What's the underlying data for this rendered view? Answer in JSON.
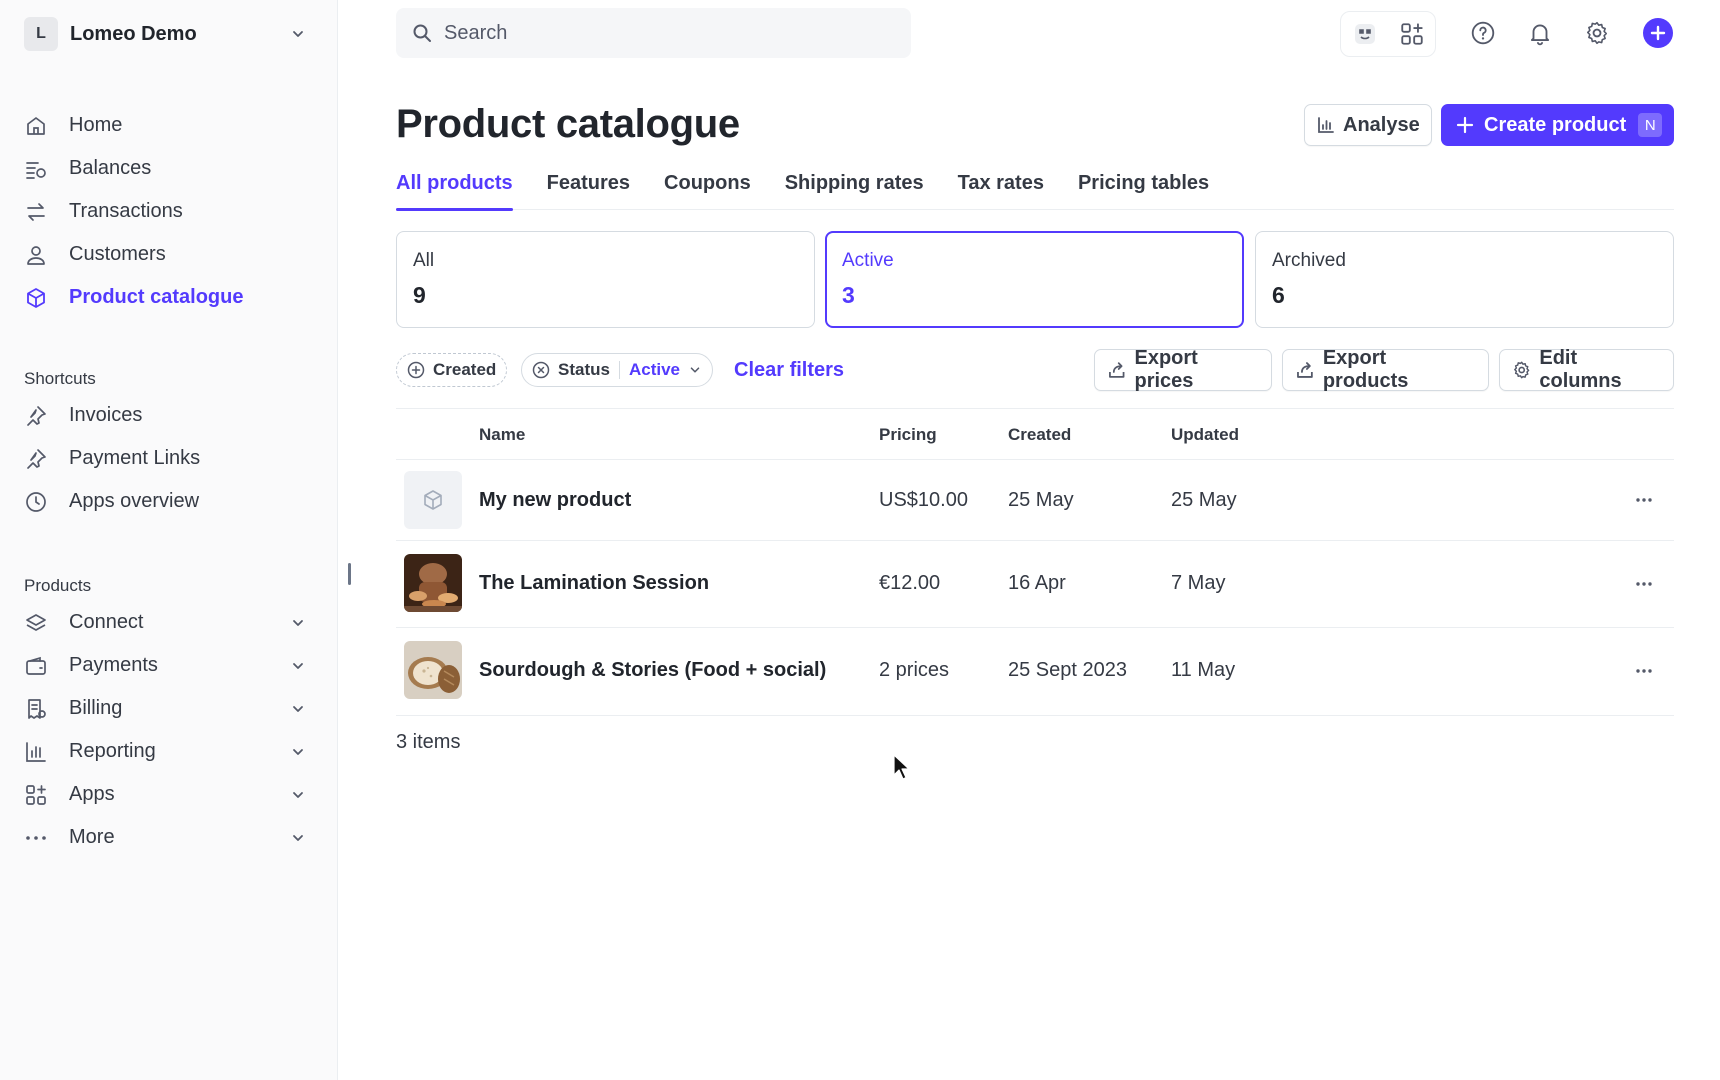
{
  "account": {
    "initial": "L",
    "name": "Lomeo Demo"
  },
  "nav": [
    {
      "label": "Home",
      "icon": "home-icon"
    },
    {
      "label": "Balances",
      "icon": "balances-icon"
    },
    {
      "label": "Transactions",
      "icon": "transactions-icon"
    },
    {
      "label": "Customers",
      "icon": "customers-icon"
    },
    {
      "label": "Product catalogue",
      "icon": "product-catalogue-icon",
      "active": true
    }
  ],
  "shortcuts": {
    "title": "Shortcuts",
    "items": [
      {
        "label": "Invoices",
        "icon": "pin-icon"
      },
      {
        "label": "Payment Links",
        "icon": "pin-icon"
      },
      {
        "label": "Apps overview",
        "icon": "clock-icon"
      }
    ]
  },
  "products_nav": {
    "title": "Products",
    "items": [
      {
        "label": "Connect",
        "icon": "connect-icon"
      },
      {
        "label": "Payments",
        "icon": "wallet-icon"
      },
      {
        "label": "Billing",
        "icon": "billing-icon"
      },
      {
        "label": "Reporting",
        "icon": "bar-chart-icon"
      },
      {
        "label": "Apps",
        "icon": "apps-icon"
      },
      {
        "label": "More",
        "icon": "ellipsis-icon"
      }
    ]
  },
  "search": {
    "placeholder": "Search"
  },
  "colors": {
    "accent": "#533afd",
    "text": "#353a44",
    "border": "#d5dbe1"
  },
  "page": {
    "title": "Product catalogue",
    "analyse_label": "Analyse",
    "create_label": "Create product",
    "create_shortcut": "N"
  },
  "tabs": [
    {
      "label": "All products",
      "active": true
    },
    {
      "label": "Features"
    },
    {
      "label": "Coupons"
    },
    {
      "label": "Shipping rates"
    },
    {
      "label": "Tax rates"
    },
    {
      "label": "Pricing tables"
    }
  ],
  "status_cards": [
    {
      "label": "All",
      "count": "9"
    },
    {
      "label": "Active",
      "count": "3",
      "active": true
    },
    {
      "label": "Archived",
      "count": "6"
    }
  ],
  "filters": {
    "created_label": "Created",
    "status_label": "Status",
    "status_value": "Active",
    "clear_label": "Clear filters",
    "export_prices": "Export prices",
    "export_products": "Export products",
    "edit_columns": "Edit columns"
  },
  "table": {
    "columns": [
      "Name",
      "Pricing",
      "Created",
      "Updated"
    ],
    "rows": [
      {
        "name": "My new product",
        "pricing": "US$10.00",
        "created": "25 May",
        "updated": "25 May"
      },
      {
        "name": "The Lamination Session",
        "pricing": "€12.00",
        "created": "16 Apr",
        "updated": "7 May"
      },
      {
        "name": "Sourdough & Stories (Food + social)",
        "pricing": "2 prices",
        "created": "25 Sept 2023",
        "updated": "11 May"
      }
    ],
    "footer": "3 items"
  }
}
